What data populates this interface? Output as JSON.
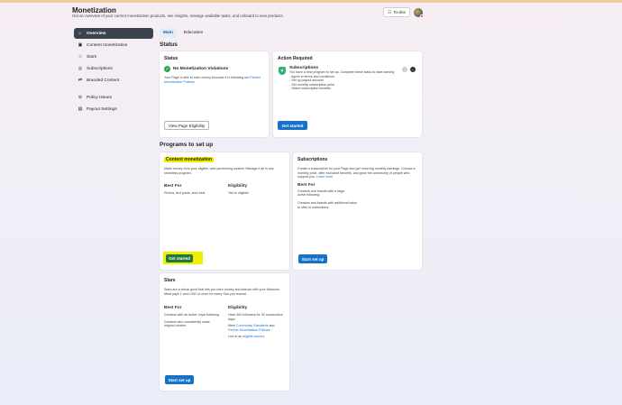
{
  "header": {
    "title": "Monetization",
    "subtitle": "Get an overview of your current monetization products, see insights, manage available tasks, and onboard to new products.",
    "todos_label": "To-dos"
  },
  "sidebar": {
    "items": [
      {
        "label": "Overview",
        "icon": "home-icon"
      },
      {
        "label": "Content monetization",
        "icon": "content-icon"
      },
      {
        "label": "Stars",
        "icon": "star-icon"
      },
      {
        "label": "Subscriptions",
        "icon": "subscriptions-icon"
      },
      {
        "label": "Branded Content",
        "icon": "branded-icon"
      },
      {
        "label": "Policy Issues",
        "icon": "policy-icon"
      },
      {
        "label": "Payout Settings",
        "icon": "payout-icon"
      }
    ]
  },
  "tabs": [
    {
      "label": "Main"
    },
    {
      "label": "Education"
    }
  ],
  "status_section": {
    "heading": "Status",
    "status_card": {
      "title": "Status",
      "violation_title": "No Monetization Violations",
      "body": "Your Page is able to earn money because it is following our",
      "link": "Partner Monetization Policies",
      "button": "View Page Eligibility"
    },
    "action_card": {
      "title": "Action Required",
      "item_title": "Subscriptions",
      "item_body": "You have a new program to set up. Complete these tasks to start earning:",
      "tasks": [
        "- Agree to terms and conditions",
        "- Set up payout account",
        "- Set monthly subscription price",
        "- Select subscription benefits"
      ],
      "button": "Get started"
    }
  },
  "programs": {
    "heading": "Programs to set up",
    "content_monetization": {
      "title": "Content monetization",
      "desc": "Make money from your eligible, web performing content. Manage it all in one seamless program.",
      "best_for_label": "Best For",
      "best_for": "Photos, text posts, and reels",
      "eligibility_label": "Eligibility",
      "eligibility": "You're eligible!",
      "button": "Get started"
    },
    "subscriptions": {
      "title": "Subscriptions",
      "desc": "Create a subscription for your Page and get recurring monthly earnings. Choose a monthly price, offer exclusive benefits, and grow the community of people who support you.",
      "learn_more": "Learn more",
      "best_for_label": "Best For",
      "best_for_1": "Creators and brands with a large, active following",
      "best_for_2": "Creators and brands with additional value to offer to subscribers",
      "button": "Start set up"
    },
    "stars": {
      "title": "Stars",
      "desc": "Stars are a virtual good that lets you earn money and interact with your followers. Meta pays 1 cent USD or more for every Star you receive.",
      "best_for_label": "Best For",
      "best_for_1": "Creators with an active, loyal following",
      "best_for_2": "Creators who consistently make original content",
      "eligibility_label": "Eligibility",
      "elig_1": "Have 500 followers for 30 consecutive days",
      "elig_2_prefix": "Meet",
      "elig_2_link_a": "Community Standards",
      "elig_2_mid": "and",
      "elig_2_link_b": "Partner Monetization Policies",
      "elig_3_prefix": "Live in an",
      "elig_3_link": "eligible country",
      "button": "Start set up"
    }
  },
  "colors": {
    "accent": "#1672c9",
    "highlight": "#f2ee00",
    "nav_active": "#39434d",
    "success": "#31a24c"
  }
}
